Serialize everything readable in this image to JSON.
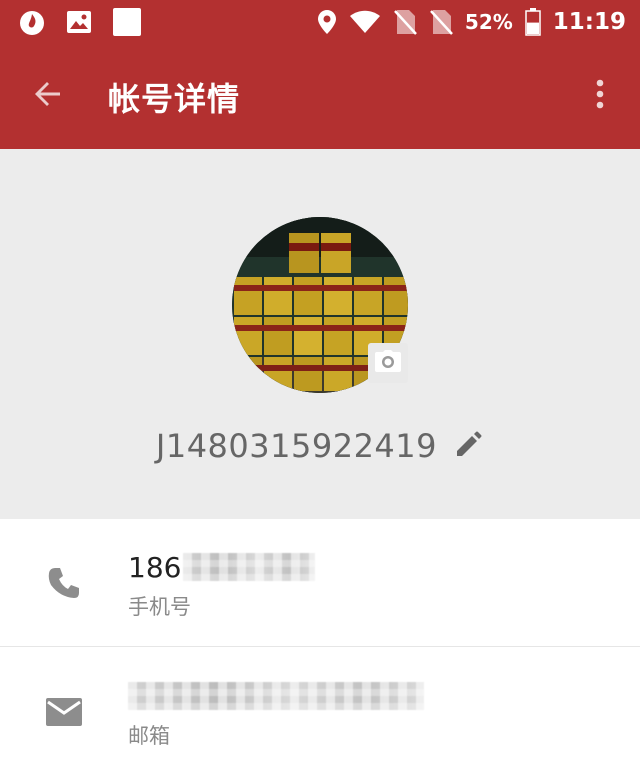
{
  "status_bar": {
    "battery_percent": "52%",
    "battery_level": 0.52,
    "time": "11:19",
    "left_icons": [
      "app-flame-icon",
      "image-notification-icon",
      "blank-notification-icon"
    ],
    "right_icons": [
      "location-icon",
      "wifi-icon",
      "no-sim-icon",
      "no-sim-icon",
      "battery-icon"
    ]
  },
  "toolbar": {
    "title": "帐号详情",
    "back_icon": "arrow-back-icon",
    "menu_icon": "more-vertical-icon",
    "background_color": "#b33030"
  },
  "profile": {
    "username": "J1480315922419",
    "avatar_image": "photo of stacked gold beverage cans",
    "camera_icon": "camera-icon",
    "edit_icon": "pencil-icon"
  },
  "details": {
    "phone": {
      "value_prefix": "186",
      "label": "手机号",
      "icon": "phone-icon",
      "value_obscured": true
    },
    "email": {
      "label": "邮箱",
      "icon": "mail-icon",
      "value_obscured": true
    }
  }
}
